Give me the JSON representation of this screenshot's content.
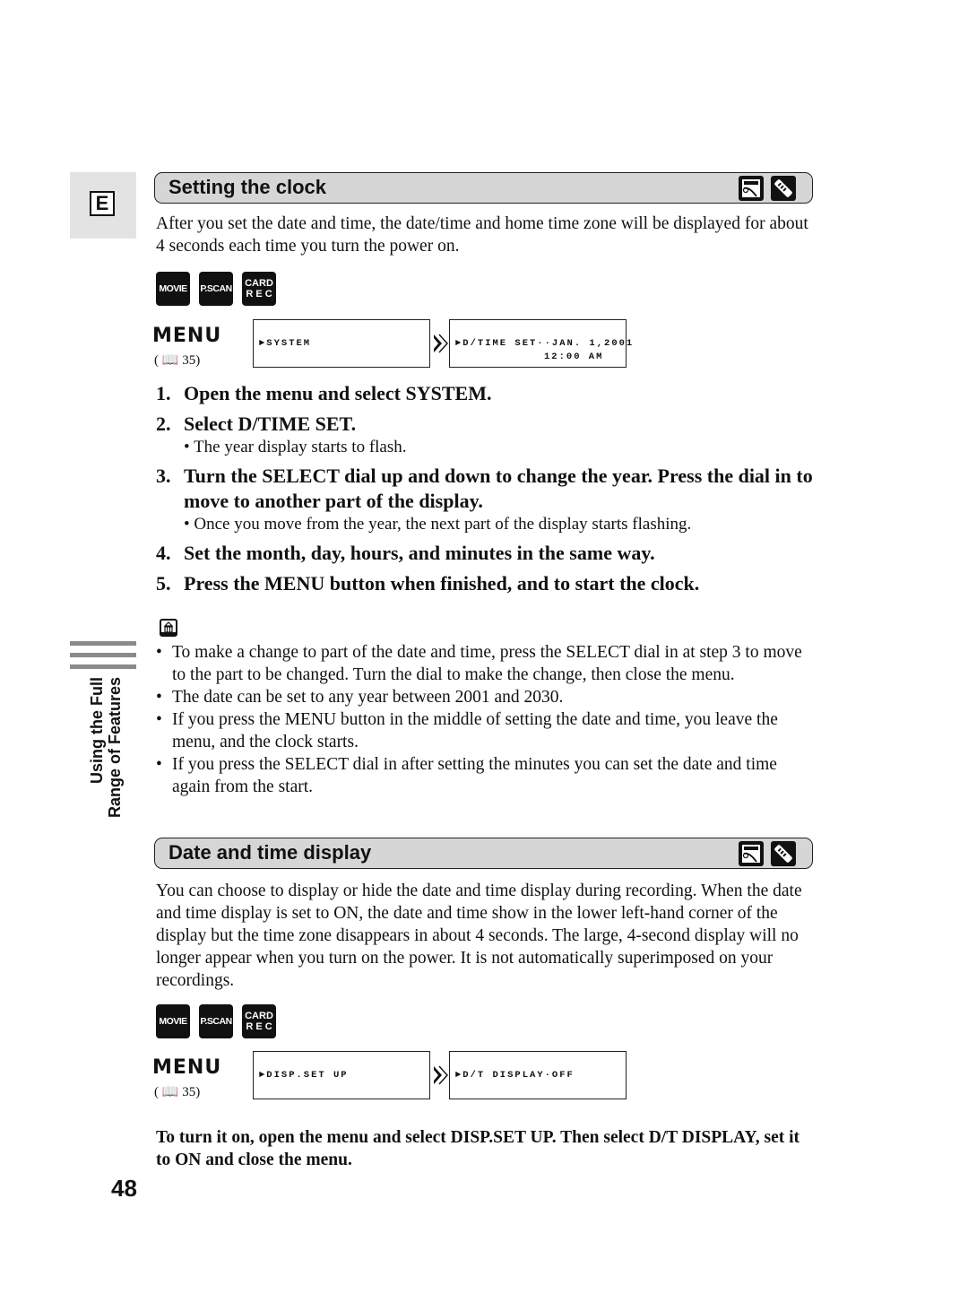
{
  "language_tab": "E",
  "side_label": {
    "line1": "Using the Full",
    "line2": "Range of Features"
  },
  "page_number": "48",
  "modes": {
    "movie": "MOVIE",
    "pscan": "P.SCAN",
    "card_top": "CARD",
    "card_bottom": "R E C"
  },
  "menu": {
    "word": "MENU",
    "ref": "35"
  },
  "section1": {
    "title": "Setting the clock",
    "icons": [
      "camera-icon",
      "remote-control-icon"
    ],
    "intro": "After you set the date and time, the date/time and home time zone will be displayed for about 4 seconds each time you turn the power on.",
    "lcd1": "►SYSTEM",
    "lcd2_line1": "►D/TIME SET··JAN. 1,2001",
    "lcd2_line2": "12:00 AM",
    "steps": [
      {
        "num": "1.",
        "text": "Open the menu and select SYSTEM."
      },
      {
        "num": "2.",
        "text": "Select D/TIME SET.",
        "sub": "The year display starts to flash."
      },
      {
        "num": "3.",
        "text": "Turn the SELECT dial up and down to change the year. Press the dial in to move to another part of the display.",
        "sub": "Once you move from the year, the next part of the display starts flashing."
      },
      {
        "num": "4.",
        "text": "Set the month, day, hours, and minutes in the same way."
      },
      {
        "num": "5.",
        "text": "Press the MENU button when finished, and to start the clock."
      }
    ],
    "notes": [
      "To make a change to part of the date and time, press the SELECT dial in at step 3 to move to the part to be changed. Turn the dial to make the change, then close the menu.",
      "The date can be set to any year between 2001 and 2030.",
      "If you press the MENU button in the middle of setting the date and time, you leave the menu, and the clock starts.",
      "If you press the SELECT dial in after setting the minutes you can set the date and time again from the start."
    ]
  },
  "section2": {
    "title": "Date and time display",
    "icons": [
      "camera-icon",
      "remote-control-icon"
    ],
    "intro": "You can choose to display or hide the date and time display during recording. When the date and time display is set to ON, the date and time show in the lower left-hand corner of the display but the time zone disappears in about 4 seconds. The large, 4-second display will no longer appear when you turn on the power. It is not automatically superimposed on your recordings.",
    "lcd1": "►DISP.SET UP",
    "lcd2_line1": "►D/T DISPLAY·OFF",
    "final": "To turn it on, open the menu and select DISP.SET UP. Then select D/T DISPLAY, set it to ON and close the menu."
  }
}
